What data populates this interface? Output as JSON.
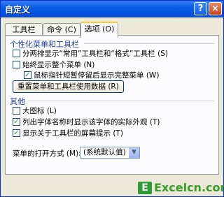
{
  "window": {
    "title": "自定义",
    "help": "?",
    "close": "×"
  },
  "tabs": [
    {
      "label": "工具栏 (B)"
    },
    {
      "label": "命令 (C)"
    },
    {
      "label": "选项 (O)"
    }
  ],
  "sections": {
    "personalized": {
      "title": "个性化菜单和工具栏",
      "items": [
        {
          "label": "分两排显示“常用”工具栏和“格式”工具栏 (S)",
          "checked": false
        },
        {
          "label": "始终显示整个菜单 (N)",
          "checked": false
        },
        {
          "label": "鼠标指针短暂停留后显示完整菜单 (W)",
          "checked": true
        }
      ],
      "reset_button": "重置菜单和工具栏使用数据 (R)"
    },
    "other": {
      "title": "其他",
      "items": [
        {
          "label": "大图标 (L)",
          "checked": false
        },
        {
          "label": "列出字体名称时显示该字体的实际外观 (T)",
          "checked": true
        },
        {
          "label": "显示关于工具栏的屏幕提示 (T)",
          "checked": true
        }
      ]
    }
  },
  "menu_open_mode": {
    "label": "菜单的打开方式 (M):",
    "value": "(系统默认值)"
  },
  "watermark": {
    "icon": "E",
    "text": "Excelcn.com"
  },
  "colors": {
    "accent": "#0a5ce8",
    "check": "#21a121"
  }
}
